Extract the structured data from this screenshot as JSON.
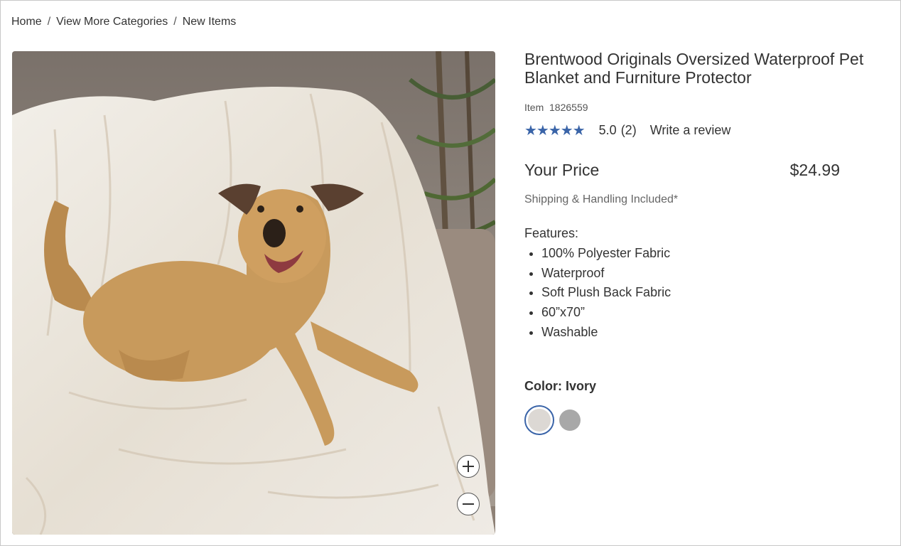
{
  "breadcrumb": {
    "home": "Home",
    "categories": "View More Categories",
    "current": "New Items",
    "separator": "/"
  },
  "product": {
    "title": "Brentwood Originals Oversized Waterproof Pet Blanket and Furniture Protector",
    "item_label": "Item",
    "item_number": "1826559",
    "stars": "★★★★★",
    "rating": "5.0",
    "review_count": "(2)",
    "write_review": "Write a review",
    "price_label": "Your Price",
    "price": "$24.99",
    "shipping": "Shipping & Handling Included*",
    "features_label": "Features:",
    "features": [
      "100% Polyester Fabric",
      "Waterproof",
      "Soft Plush Back Fabric",
      "60”x70”",
      "Washable"
    ],
    "color_label": "Color: Ivory"
  },
  "colors": {
    "accent": "#3a64a8",
    "ivory_swatch": "#dcd8d4",
    "gray_swatch": "#a8a8a8"
  },
  "image": {
    "alt": "dog on ivory blanket"
  }
}
